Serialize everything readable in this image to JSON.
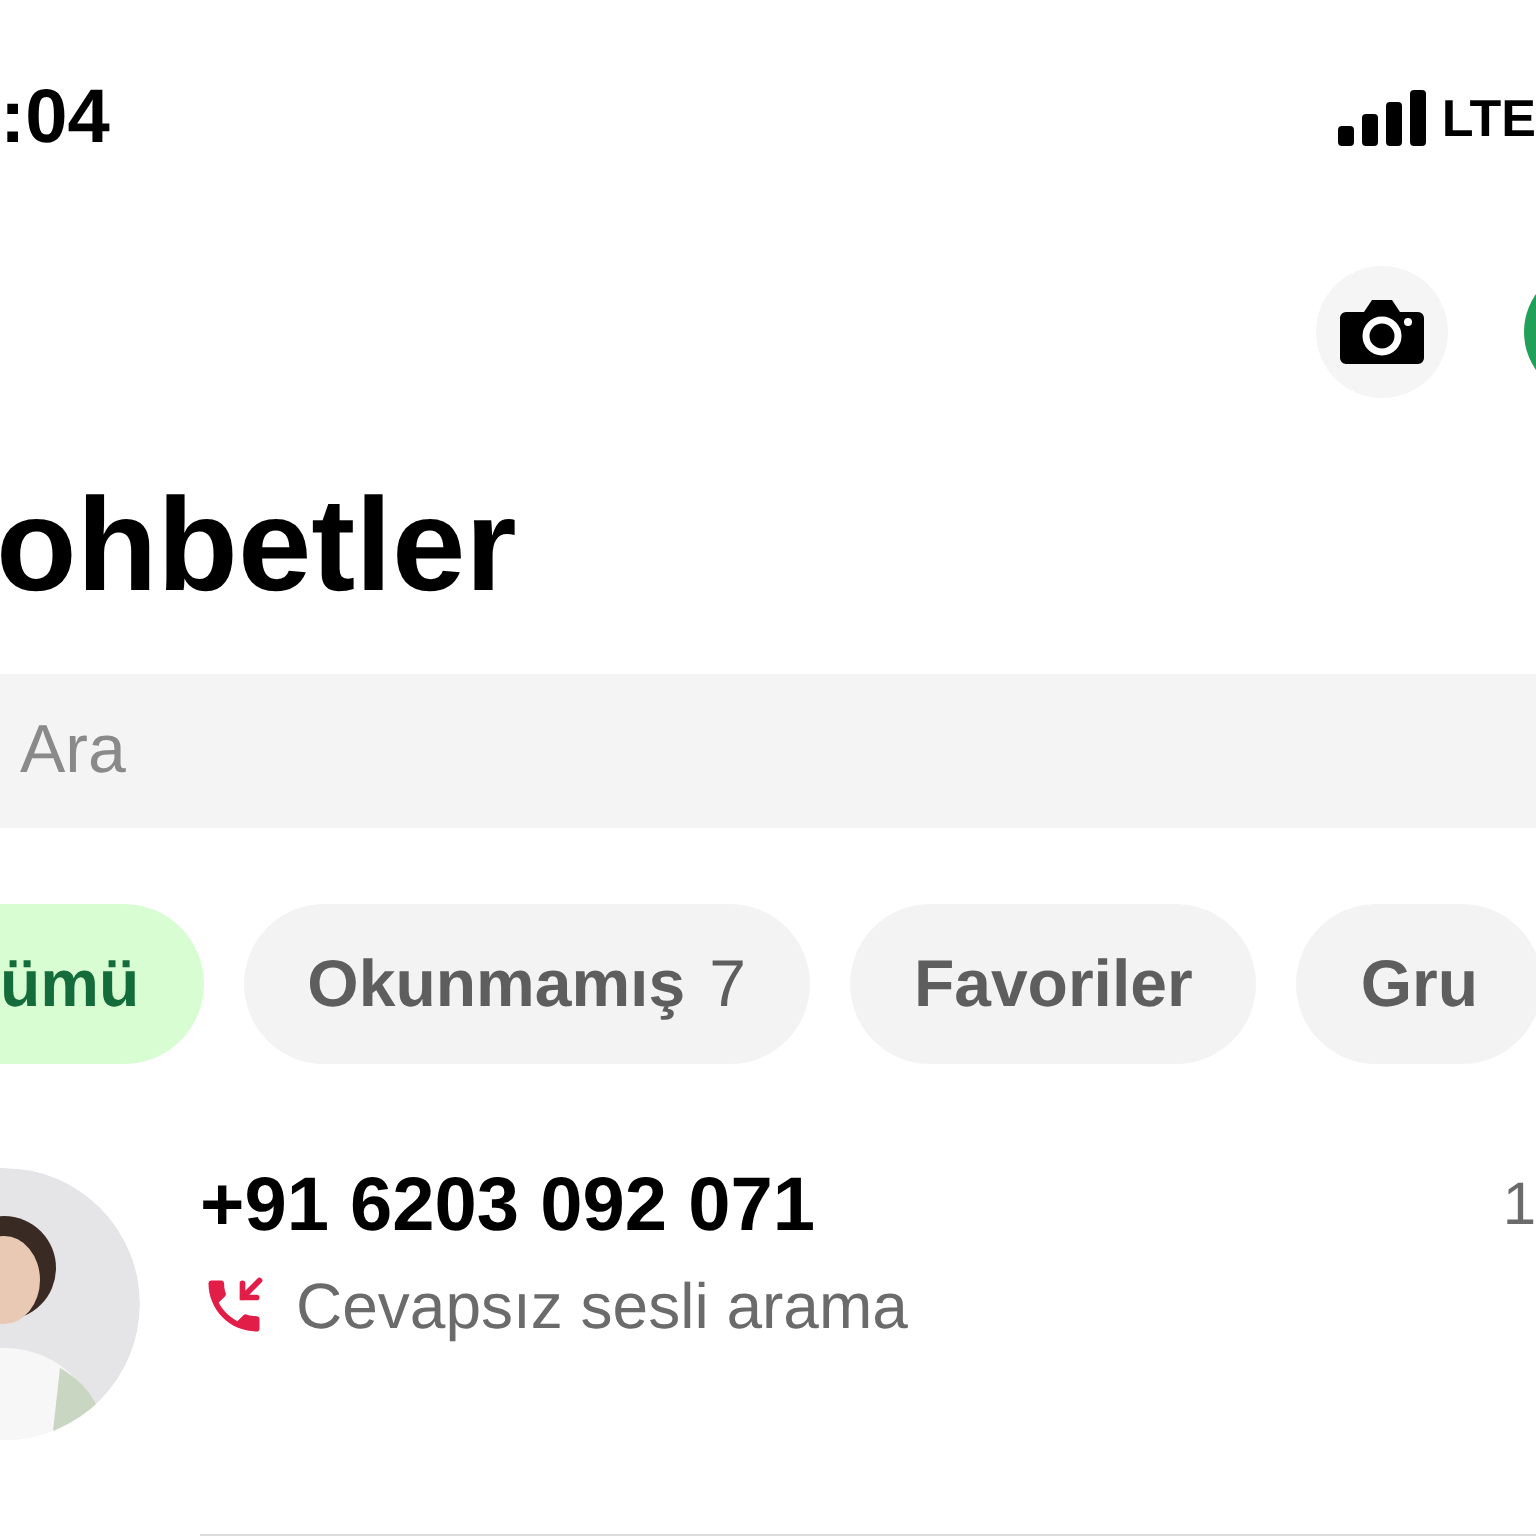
{
  "status_bar": {
    "time": ":04",
    "network": "LTE"
  },
  "header": {
    "title": "ohbetler"
  },
  "search": {
    "placeholder": "Ara"
  },
  "filters": [
    {
      "label": "ümü",
      "selected": true
    },
    {
      "label": "Okunmamış",
      "count": "7",
      "selected": false
    },
    {
      "label": "Favoriler",
      "selected": false
    },
    {
      "label": "Gru",
      "selected": false
    }
  ],
  "chats": [
    {
      "name": "+91 6203 092 071",
      "time": "1",
      "last_message": "Cevapsız sesli arama",
      "kind": "missed_call"
    }
  ]
}
